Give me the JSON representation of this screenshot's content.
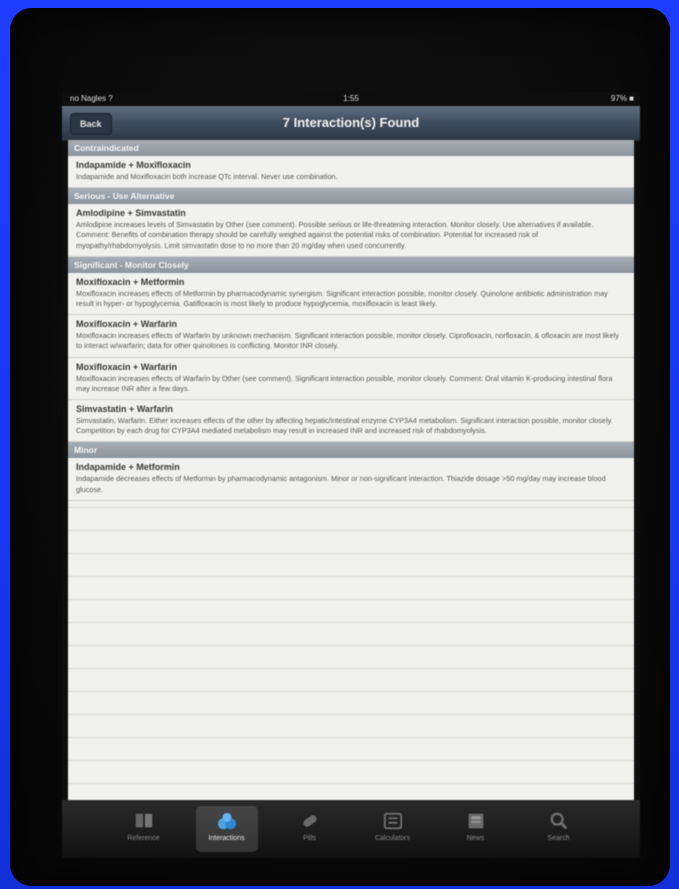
{
  "status_bar": {
    "carrier": "no Nagles ?",
    "time": "1:55",
    "battery": "97% ■"
  },
  "nav": {
    "back_label": "Back",
    "title": "7 Interaction(s) Found"
  },
  "sections": [
    {
      "header": "Contraindicated",
      "items": [
        {
          "title": "Indapamide + Moxifloxacin",
          "desc": "Indapamide and Moxifloxacin both increase QTc interval. Never use combination."
        }
      ]
    },
    {
      "header": "Serious - Use Alternative",
      "items": [
        {
          "title": "Amlodipine + Simvastatin",
          "desc": "Amlodipine increases levels of Simvastatin by Other (see comment). Possible serious or life-threatening interaction. Monitor closely. Use alternatives if available. Comment: Benefits of combination therapy should be carefully weighed against the potential risks of combination. Potential for increased risk of myopathy/rhabdomyolysis. Limit simvastatin dose to no more than 20 mg/day when used concurrently."
        }
      ]
    },
    {
      "header": "Significant - Monitor Closely",
      "items": [
        {
          "title": "Moxifloxacin + Metformin",
          "desc": "Moxifloxacin increases effects of Metformin by pharmacodynamic synergism. Significant interaction possible, monitor closely. Quinolone antibiotic administration may result in hyper- or hypoglycemia. Gatifloxacin is most likely to produce hypoglycemia, moxifloxacin is least likely."
        },
        {
          "title": "Moxifloxacin + Warfarin",
          "desc": "Moxifloxacin increases effects of Warfarin by unknown mechanism. Significant interaction possible, monitor closely. Ciprofloxacin, norfloxacin, & ofloxacin are most likely to interact w/warfarin; data for other quinolones is conflicting. Monitor INR closely."
        },
        {
          "title": "Moxifloxacin + Warfarin",
          "desc": "Moxifloxacin increases effects of Warfarin by Other (see comment). Significant interaction possible, monitor closely. Comment: Oral vitamin K-producing intestinal flora may increase INR after a few days."
        },
        {
          "title": "Simvastatin + Warfarin",
          "desc": "Simvastatin, Warfarin. Either increases effects of the other by affecting hepatic/intestinal enzyme CYP3A4 metabolism. Significant interaction possible, monitor closely. Competition by each drug for CYP3A4 mediated metabolism may result in increased INR and increased risk of rhabdomyolysis."
        }
      ]
    },
    {
      "header": "Minor",
      "items": [
        {
          "title": "Indapamide + Metformin",
          "desc": "Indapamide decreases effects of Metformin by pharmacodynamic antagonism. Minor or non-significant interaction. Thiazide dosage >50 mg/day may increase blood glucose."
        }
      ]
    }
  ],
  "tabs": [
    {
      "label": "Reference",
      "icon": "book-icon",
      "active": false
    },
    {
      "label": "Interactions",
      "icon": "pills-icon",
      "active": true
    },
    {
      "label": "Pills",
      "icon": "pill-identifier-icon",
      "active": false
    },
    {
      "label": "Calculators",
      "icon": "calculator-icon",
      "active": false
    },
    {
      "label": "News",
      "icon": "news-icon",
      "active": false
    },
    {
      "label": "Search",
      "icon": "search-icon",
      "active": false
    }
  ]
}
